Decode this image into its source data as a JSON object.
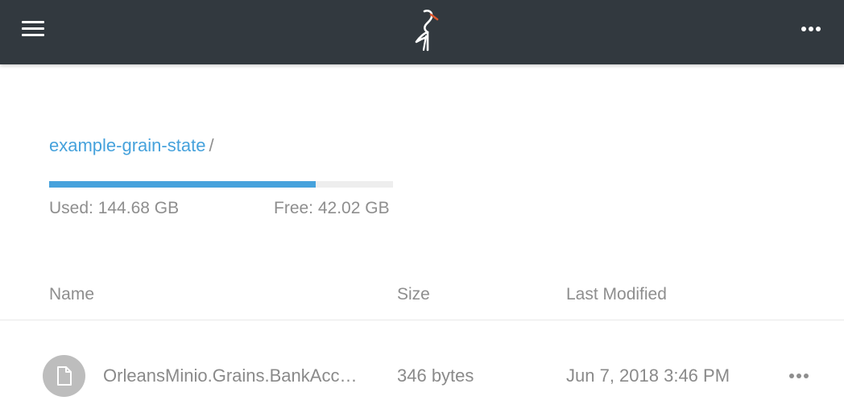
{
  "topbar": {
    "menu_icon": "hamburger-menu-icon",
    "logo_icon": "minio-heron-logo",
    "more_icon": "more-horizontal-icon"
  },
  "breadcrumb": {
    "bucket": "example-grain-state",
    "separator": "/"
  },
  "usage": {
    "used_label": "Used: 144.68 GB",
    "free_label": "Free: 42.02 GB",
    "used_fraction": 0.775
  },
  "table": {
    "columns": [
      "Name",
      "Size",
      "Last Modified"
    ],
    "rows": [
      {
        "icon": "file-icon",
        "name": "OrleansMinio.Grains.BankAcc…",
        "size": "346 bytes",
        "modified": "Jun 7, 2018 3:46 PM",
        "actions_icon": "more-horizontal-icon"
      }
    ]
  },
  "colors": {
    "topbar_bg": "#32393f",
    "accent": "#46a2dc",
    "logo_accent": "#e0582f",
    "text_muted": "#8e8e8e",
    "icon_bg": "#bdbdbd"
  }
}
